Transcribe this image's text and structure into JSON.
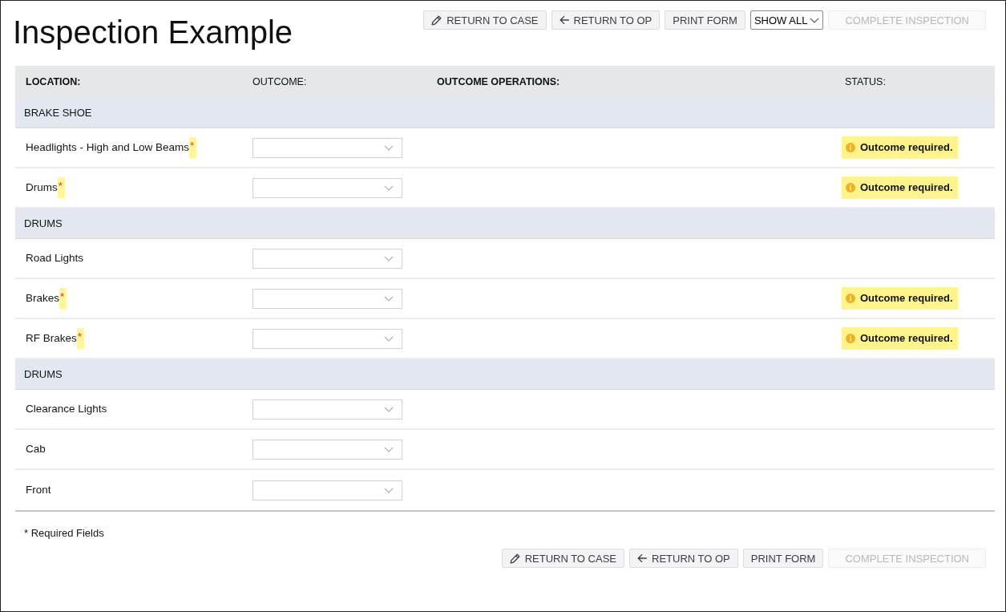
{
  "title": "Inspection Example",
  "top_toolbar": [
    {
      "kind": "edit",
      "label": "RETURN TO CASE",
      "disabled": false
    },
    {
      "kind": "back",
      "label": "RETURN TO OP",
      "disabled": false
    },
    {
      "kind": "plain",
      "label": "PRINT FORM",
      "disabled": false
    },
    {
      "kind": "dropdown",
      "label": "SHOW ALL",
      "disabled": false
    },
    {
      "kind": "plain",
      "label": "COMPLETE INSPECTION",
      "disabled": true
    }
  ],
  "table": {
    "columns": [
      {
        "label": "LOCATION:",
        "bold": true
      },
      {
        "label": "OUTCOME:",
        "bold": false
      },
      {
        "label": "OUTCOME OPERATIONS:",
        "bold": true
      },
      {
        "label": "STATUS:",
        "bold": false
      }
    ],
    "groups": [
      {
        "name": "BRAKE SHOE",
        "rows": [
          {
            "location": "Headlights - High and Low Beams",
            "required": true,
            "required_mark": "*",
            "status": "Outcome required."
          },
          {
            "location": "Drums",
            "required": true,
            "required_mark": "*",
            "status": "Outcome required."
          }
        ]
      },
      {
        "name": "DRUMS",
        "rows": [
          {
            "location": "Road Lights",
            "required": false
          },
          {
            "location": "Brakes",
            "required": true,
            "required_mark": "*",
            "status": "Outcome required."
          },
          {
            "location": "RF Brakes",
            "required": true,
            "required_mark": "*",
            "status": "Outcome required."
          }
        ]
      },
      {
        "name": "DRUMS",
        "rows": [
          {
            "location": "Clearance Lights",
            "required": false
          },
          {
            "location": "Cab",
            "required": false
          },
          {
            "location": "Front",
            "required": false
          }
        ]
      }
    ]
  },
  "footnote": "* Required Fields",
  "bottom_toolbar": [
    {
      "kind": "edit",
      "label": "RETURN TO CASE",
      "disabled": false
    },
    {
      "kind": "back",
      "label": "RETURN TO OP",
      "disabled": false
    },
    {
      "kind": "plain",
      "label": "PRINT FORM",
      "disabled": false
    },
    {
      "kind": "plain",
      "label": "COMPLETE INSPECTION",
      "disabled": true
    }
  ]
}
